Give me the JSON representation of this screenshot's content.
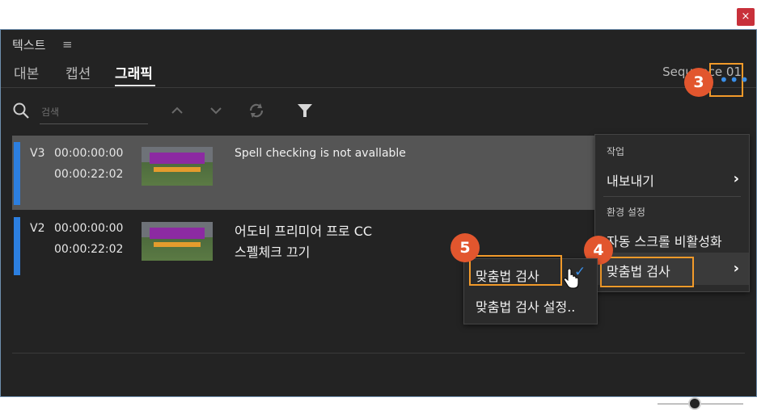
{
  "window": {
    "close_label": "×"
  },
  "panel": {
    "title": "텍스트",
    "menu_glyph": "≡"
  },
  "tabs": [
    {
      "label": "대본"
    },
    {
      "label": "캡션"
    },
    {
      "label": "그래픽",
      "active": true
    }
  ],
  "sequence_label": "Sequence 01",
  "search": {
    "placeholder": "검색"
  },
  "toolbar_icons": [
    "search-icon",
    "chevron-up-icon",
    "chevron-down-icon",
    "refresh-icon",
    "filter-icon",
    "more-icon"
  ],
  "more_label": "•••",
  "rows": [
    {
      "track": "V3",
      "tc_in": "00:00:00:00",
      "tc_out": "00:00:22:02",
      "caption": "Spell checking is not avallable",
      "selected": true
    },
    {
      "track": "V2",
      "tc_in": "00:00:00:00",
      "tc_out": "00:00:22:02",
      "caption_line1": "어도비 프리미어 프로 CC",
      "caption_line2": "스펠체크 끄기",
      "selected": false
    }
  ],
  "context_menu": {
    "section_work": "작업",
    "export": "내보내기",
    "section_prefs": "환경 설정",
    "auto_scroll": "자동 스크롤 비활성화",
    "spellcheck": "맞춤법 검사"
  },
  "submenu": {
    "spellcheck": "맞춤법 검사",
    "spellcheck_settings": "맞춤법 검사 설정..",
    "checked": "✓"
  },
  "badges": [
    "3",
    "4",
    "5"
  ],
  "colors": {
    "accent_blue": "#2c7fe0",
    "highlight_orange": "#f29a2a",
    "badge_red": "#e2562e",
    "close_red": "#c8303a"
  }
}
